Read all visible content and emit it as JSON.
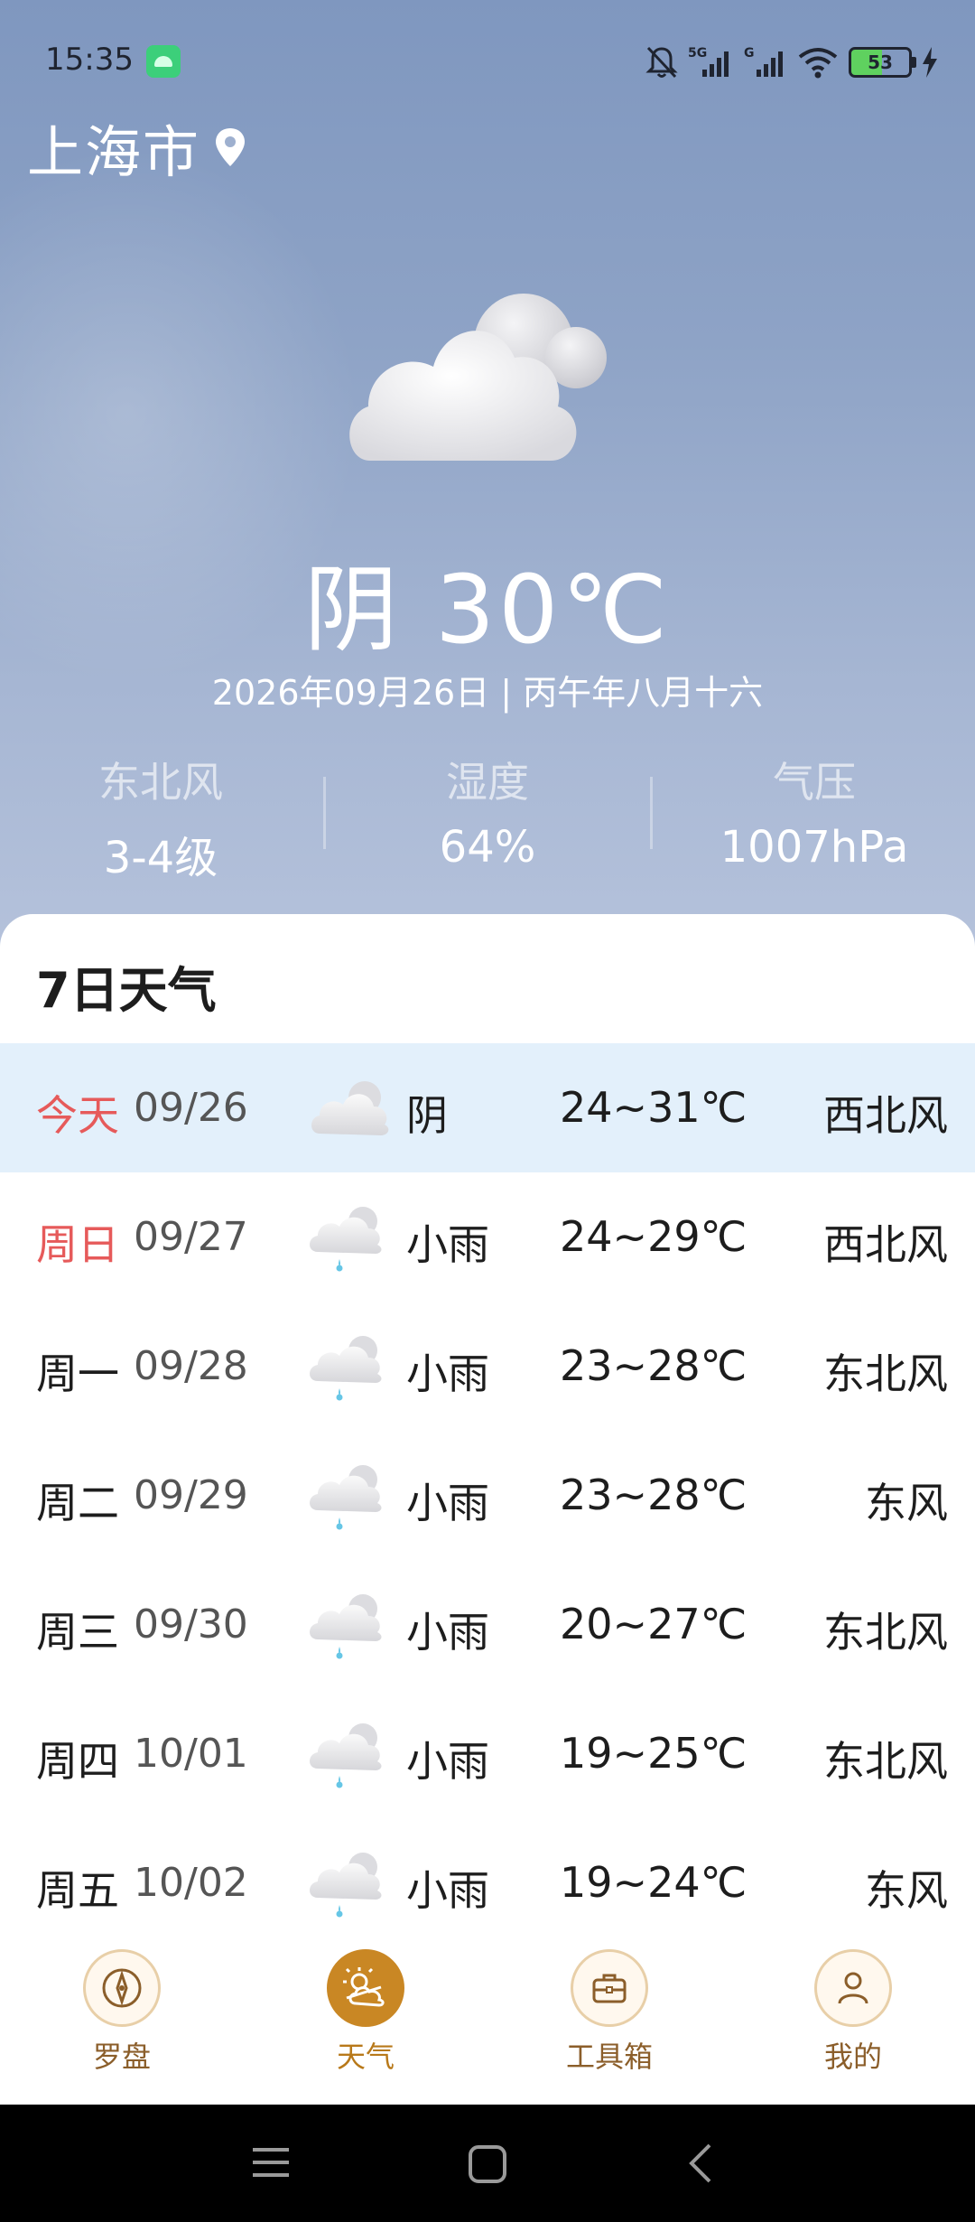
{
  "status_bar": {
    "time": "15:35",
    "battery": "53",
    "network_label_1": "5G",
    "network_label_2": "G"
  },
  "location": {
    "city": "上海市"
  },
  "current": {
    "condition_temp": "阴 30℃",
    "date_line": "2026年09月26日 | 丙午年八月十六",
    "stats": [
      {
        "label": "东北风",
        "value": "3-4级"
      },
      {
        "label": "湿度",
        "value": "64%"
      },
      {
        "label": "气压",
        "value": "1007hPa"
      }
    ]
  },
  "forecast": {
    "title": "7日天气",
    "days": [
      {
        "day": "今天",
        "date": "09/26",
        "cond": "阴",
        "temp": "24~31℃",
        "wind": "西北风",
        "icon": "cloudy-icon",
        "highlight": true,
        "red": true
      },
      {
        "day": "周日",
        "date": "09/27",
        "cond": "小雨",
        "temp": "24~29℃",
        "wind": "西北风",
        "icon": "light-rain-icon",
        "highlight": false,
        "red": true
      },
      {
        "day": "周一",
        "date": "09/28",
        "cond": "小雨",
        "temp": "23~28℃",
        "wind": "东北风",
        "icon": "light-rain-icon",
        "highlight": false,
        "red": false
      },
      {
        "day": "周二",
        "date": "09/29",
        "cond": "小雨",
        "temp": "23~28℃",
        "wind": "东风",
        "icon": "light-rain-icon",
        "highlight": false,
        "red": false
      },
      {
        "day": "周三",
        "date": "09/30",
        "cond": "小雨",
        "temp": "20~27℃",
        "wind": "东北风",
        "icon": "light-rain-icon",
        "highlight": false,
        "red": false
      },
      {
        "day": "周四",
        "date": "10/01",
        "cond": "小雨",
        "temp": "19~25℃",
        "wind": "东北风",
        "icon": "light-rain-icon",
        "highlight": false,
        "red": false
      },
      {
        "day": "周五",
        "date": "10/02",
        "cond": "小雨",
        "temp": "19~24℃",
        "wind": "东风",
        "icon": "light-rain-icon",
        "highlight": false,
        "red": false
      }
    ]
  },
  "nav": {
    "items": [
      {
        "label": "罗盘",
        "icon": "compass-icon",
        "active": false
      },
      {
        "label": "天气",
        "icon": "weather-icon",
        "active": true
      },
      {
        "label": "工具箱",
        "icon": "toolbox-icon",
        "active": false
      },
      {
        "label": "我的",
        "icon": "profile-icon",
        "active": false
      }
    ]
  },
  "colors": {
    "accent": "#c98724",
    "today_row_bg": "#e3f0fb",
    "weekend_red": "#e65a5a"
  }
}
